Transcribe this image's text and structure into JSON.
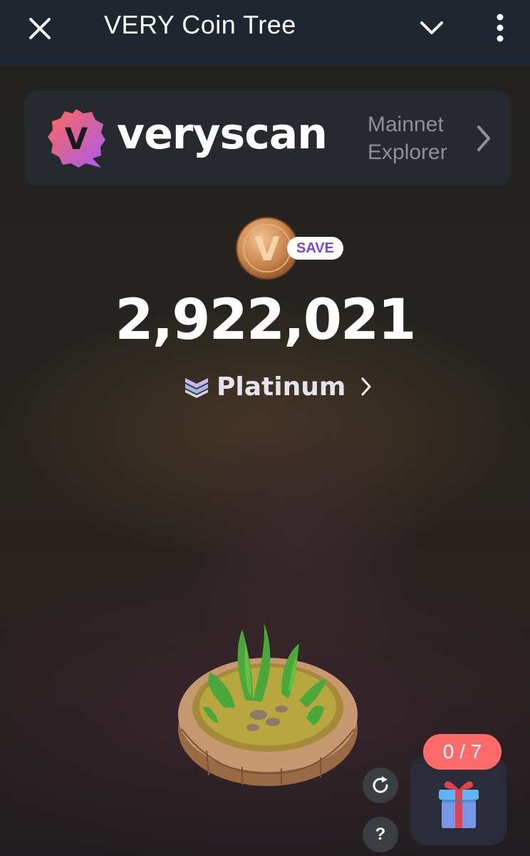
{
  "header": {
    "title": "VERY Coin Tree",
    "close_icon": "close-icon",
    "collapse_icon": "chevron-down-icon",
    "menu_icon": "more-vertical-icon"
  },
  "banner": {
    "logo_letter": "V",
    "brand": "veryscan",
    "explorer_line1": "Mainnet",
    "explorer_line2": "Explorer",
    "arrow_icon": "chevron-right-icon"
  },
  "wallet": {
    "coin_icon": "very-coin-icon",
    "coin_letter": "V",
    "save_label": "SAVE",
    "balance": "2,922,021",
    "tier_icon": "platinum-tier-icon",
    "tier": "Platinum",
    "tier_arrow_icon": "chevron-right-icon"
  },
  "actions": {
    "refresh_icon": "refresh-icon",
    "help_label": "?",
    "gift_counter": "0 / 7",
    "gift_icon": "gift-box-icon"
  },
  "colors": {
    "appbar": "#1f2630",
    "banner": "#262a2f",
    "save_text": "#7b45e0",
    "counter": "#ff6b6b",
    "logo_gradient_start": "#ff6a55",
    "logo_gradient_end": "#a85cf0"
  }
}
